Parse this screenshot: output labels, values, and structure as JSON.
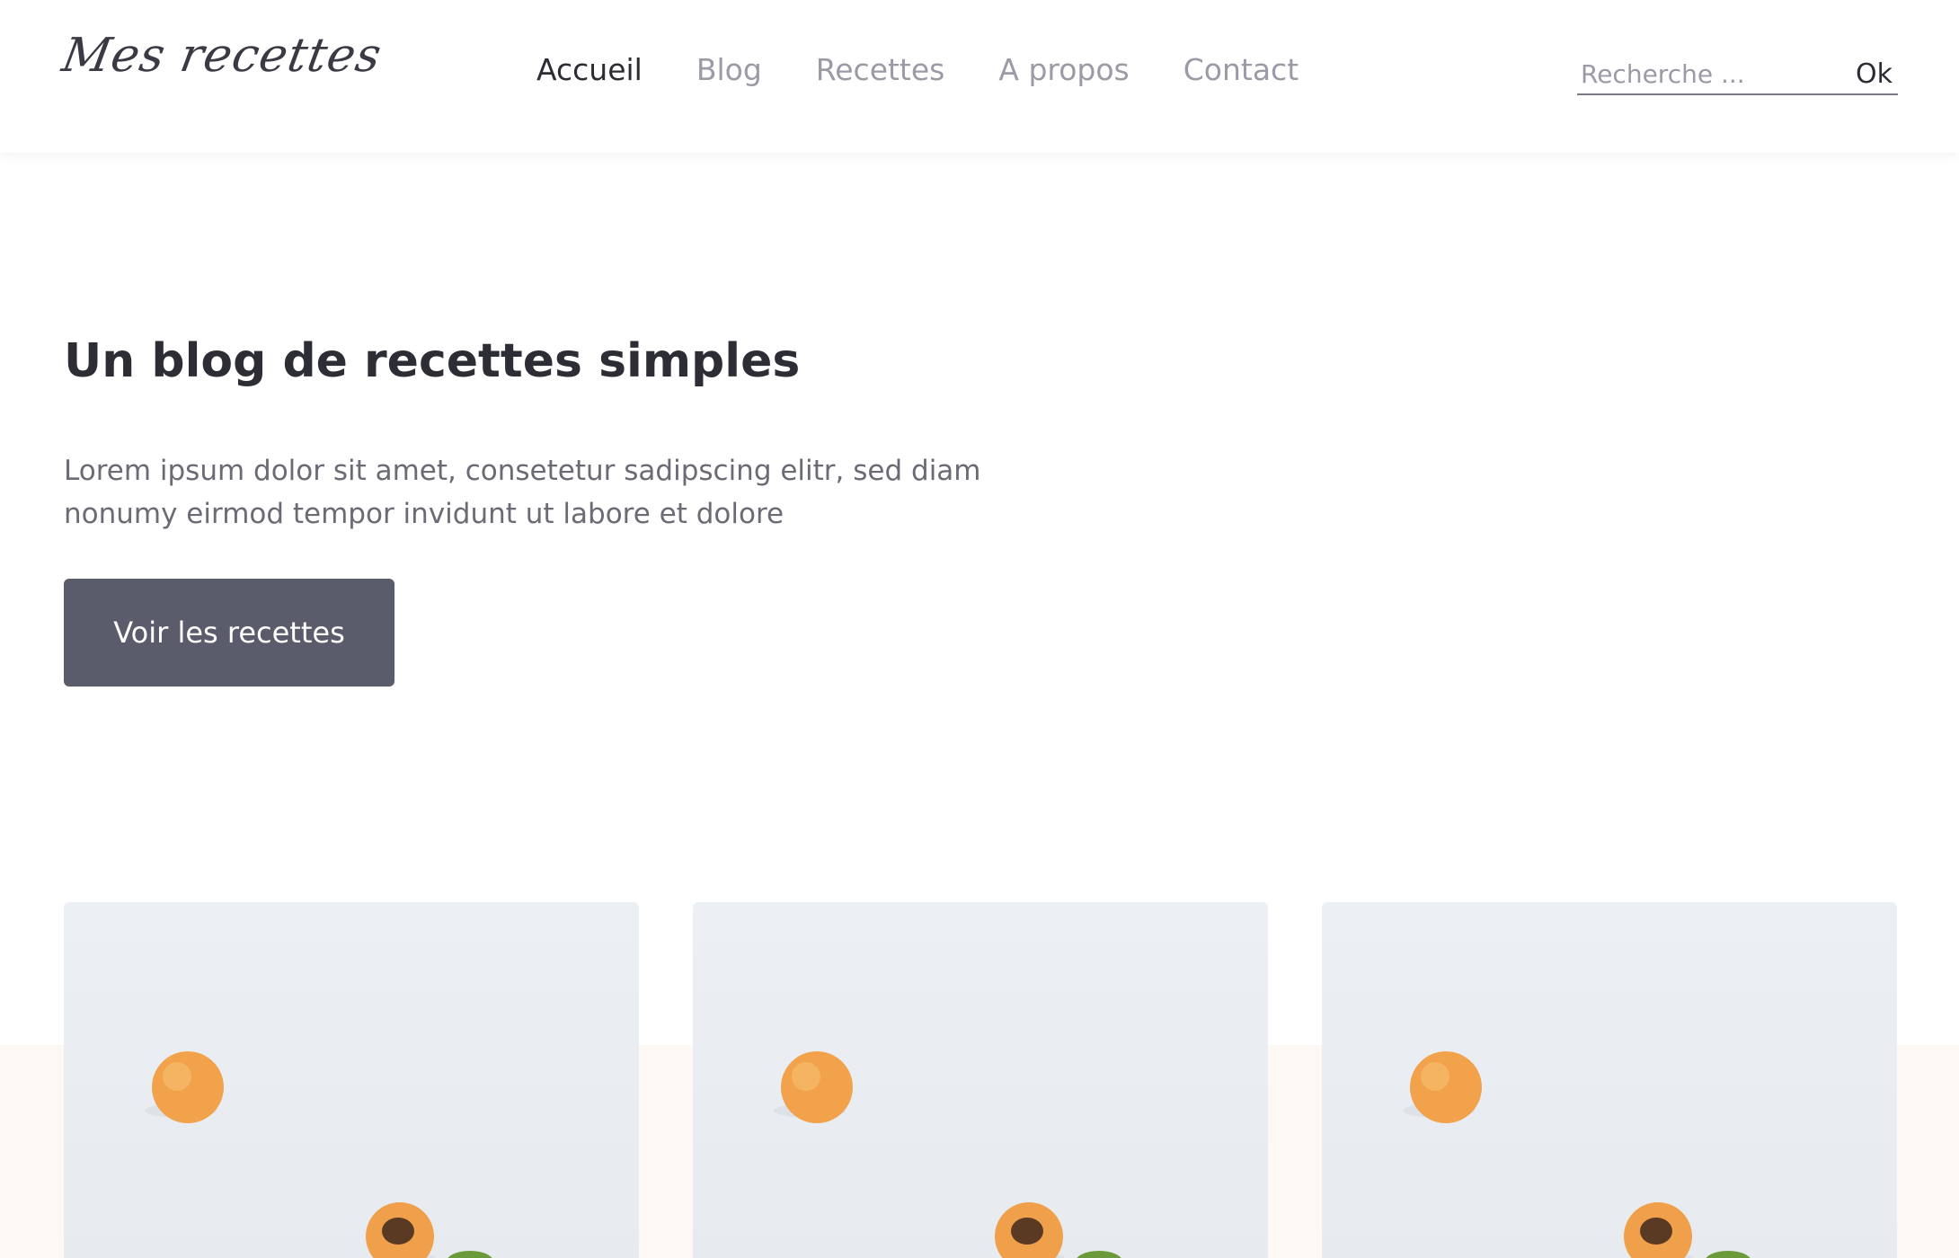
{
  "header": {
    "logo": "Mes recettes",
    "nav": [
      {
        "label": "Accueil",
        "active": true
      },
      {
        "label": "Blog",
        "active": false
      },
      {
        "label": "Recettes",
        "active": false
      },
      {
        "label": "A propos",
        "active": false
      },
      {
        "label": "Contact",
        "active": false
      }
    ],
    "search": {
      "placeholder": "Recherche ...",
      "value": "",
      "button_label": "Ok"
    }
  },
  "hero": {
    "title": "Un blog de recettes simples",
    "text": "Lorem ipsum dolor sit amet, consetetur sadipscing elitr, sed diam nonumy eirmod tempor invidunt ut labore et dolore",
    "button_label": "Voir les recettes"
  },
  "cards": [
    {
      "image": "apricots-photo"
    },
    {
      "image": "apricots-photo"
    },
    {
      "image": "apricots-photo"
    }
  ],
  "colors": {
    "primary_button": "#5b5c6b",
    "text_dark": "#2d2e35",
    "nav_inactive": "#9a9ba6",
    "band": "#fdf8f4",
    "apricot": "#f2a24a"
  }
}
